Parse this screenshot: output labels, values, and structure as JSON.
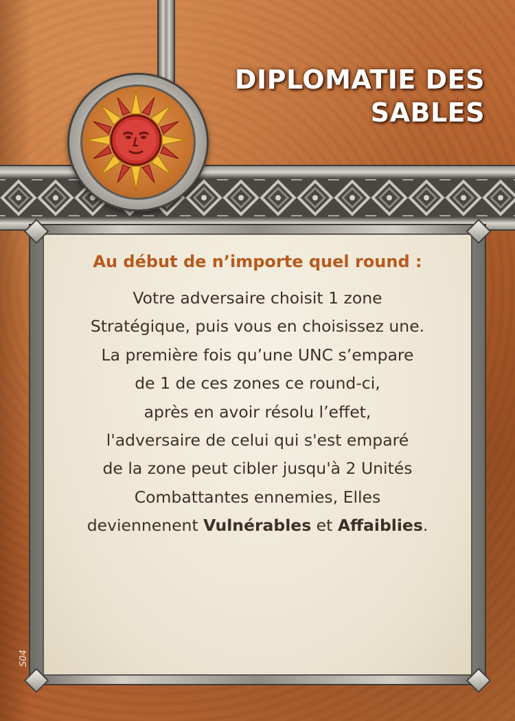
{
  "card": {
    "title_line1": "DIPLOMATIE DES",
    "title_line2": "SABLES",
    "trigger": "Au début de n’importe quel round :",
    "body_lines": [
      "Votre adversaire choisit 1 zone",
      "Stratégique, puis vous en choisissez une.",
      "La première fois qu’une UNC s’empare",
      "de 1 de ces zones ce round-ci,",
      "après en avoir résolu l’effet,",
      "l'adversaire de celui qui s'est emparé",
      "de la zone peut cibler jusqu'à 2 Unités",
      "Combattantes ennemies, Elles"
    ],
    "last_line": {
      "prefix": "deviennenent ",
      "bold1": "Vulnérables",
      "middle": " et ",
      "bold2": "Affaiblies",
      "suffix": "."
    },
    "code": "S04"
  },
  "faction_emblem": "sun-face-icon",
  "colors": {
    "background": "#b4622f",
    "title": "#ffffff",
    "trigger": "#b85a1e",
    "body": "#3e3027",
    "panel": "#efe8d8",
    "metal": "#9b9993"
  }
}
